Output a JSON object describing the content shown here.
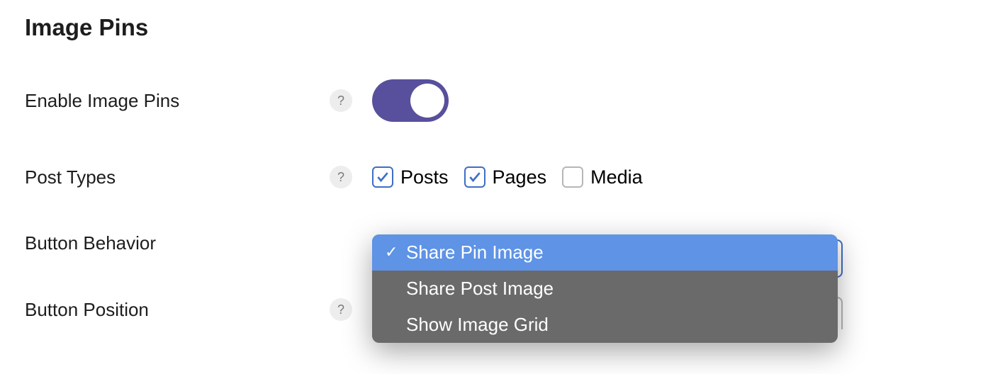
{
  "section": {
    "title": "Image Pins"
  },
  "rows": {
    "enable": {
      "label": "Enable Image Pins",
      "help": "?"
    },
    "post_types": {
      "label": "Post Types",
      "help": "?",
      "options": [
        {
          "label": "Posts",
          "checked": true
        },
        {
          "label": "Pages",
          "checked": true
        },
        {
          "label": "Media",
          "checked": false
        }
      ]
    },
    "behavior": {
      "label": "Button Behavior"
    },
    "position": {
      "label": "Button Position",
      "help": "?"
    }
  },
  "dropdown": {
    "items": [
      {
        "label": "Share Pin Image",
        "selected": true
      },
      {
        "label": "Share Post Image",
        "selected": false
      },
      {
        "label": "Show Image Grid",
        "selected": false
      }
    ]
  }
}
